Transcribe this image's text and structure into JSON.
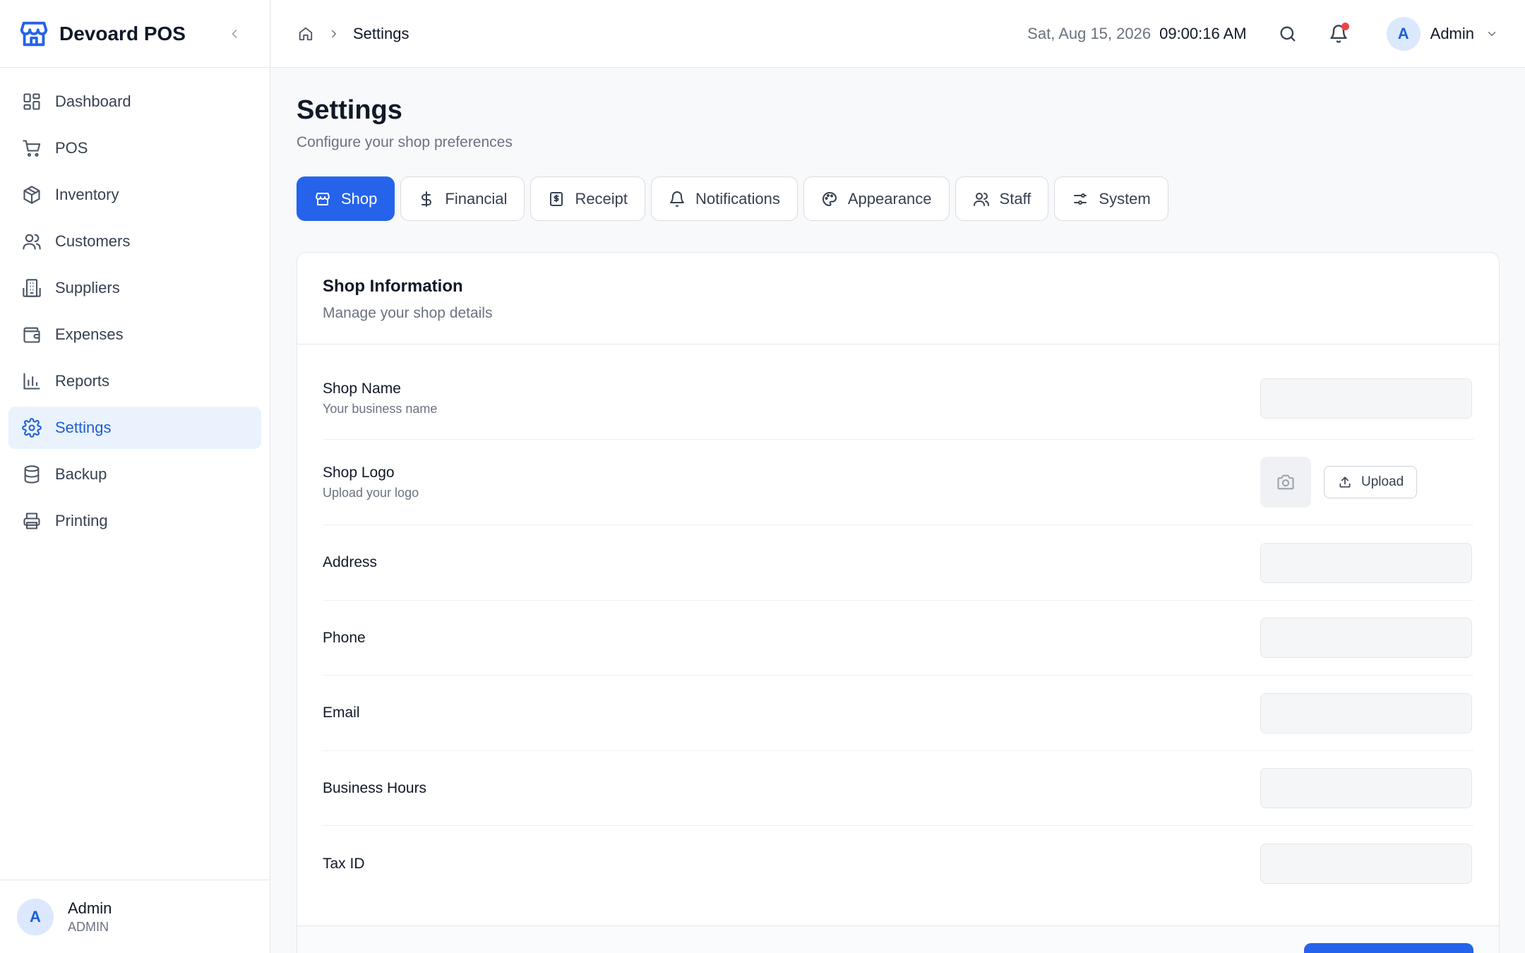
{
  "app": {
    "name": "Devoard POS"
  },
  "sidebar": {
    "items": [
      {
        "label": "Dashboard",
        "icon": "dashboard-icon"
      },
      {
        "label": "POS",
        "icon": "cart-icon"
      },
      {
        "label": "Inventory",
        "icon": "box-icon"
      },
      {
        "label": "Customers",
        "icon": "users-icon"
      },
      {
        "label": "Suppliers",
        "icon": "building-icon"
      },
      {
        "label": "Expenses",
        "icon": "wallet-icon"
      },
      {
        "label": "Reports",
        "icon": "bar-chart-icon"
      },
      {
        "label": "Settings",
        "icon": "gear-icon",
        "active": true
      },
      {
        "label": "Backup",
        "icon": "database-icon"
      },
      {
        "label": "Printing",
        "icon": "printer-icon"
      }
    ],
    "footer": {
      "avatar_initial": "A",
      "name": "Admin",
      "role": "ADMIN"
    }
  },
  "header": {
    "breadcrumb": {
      "current": "Settings"
    },
    "date": "Sat, Aug 15, 2026",
    "time": "09:00:16 AM",
    "user": {
      "avatar_initial": "A",
      "name": "Admin"
    },
    "notification_dot_color": "#ef4444"
  },
  "page": {
    "title": "Settings",
    "subtitle": "Configure your shop preferences"
  },
  "tabs": [
    {
      "label": "Shop",
      "icon": "store-icon",
      "active": true
    },
    {
      "label": "Financial",
      "icon": "dollar-icon"
    },
    {
      "label": "Receipt",
      "icon": "receipt-icon"
    },
    {
      "label": "Notifications",
      "icon": "bell-icon"
    },
    {
      "label": "Appearance",
      "icon": "palette-icon"
    },
    {
      "label": "Staff",
      "icon": "users-icon"
    },
    {
      "label": "System",
      "icon": "sliders-icon"
    }
  ],
  "card": {
    "title": "Shop Information",
    "description": "Manage your shop details",
    "fields": {
      "shop_name": {
        "label": "Shop Name",
        "hint": "Your business name",
        "value": ""
      },
      "shop_logo": {
        "label": "Shop Logo",
        "hint": "Upload your logo",
        "upload_label": "Upload"
      },
      "address": {
        "label": "Address",
        "value": ""
      },
      "phone": {
        "label": "Phone",
        "value": ""
      },
      "email": {
        "label": "Email",
        "value": ""
      },
      "business_hours": {
        "label": "Business Hours",
        "value": ""
      },
      "tax_id": {
        "label": "Tax ID",
        "value": ""
      }
    }
  },
  "colors": {
    "accent": "#2563eb",
    "active_nav_bg": "#eaf2fe",
    "active_nav_text": "#1d5fd6"
  }
}
